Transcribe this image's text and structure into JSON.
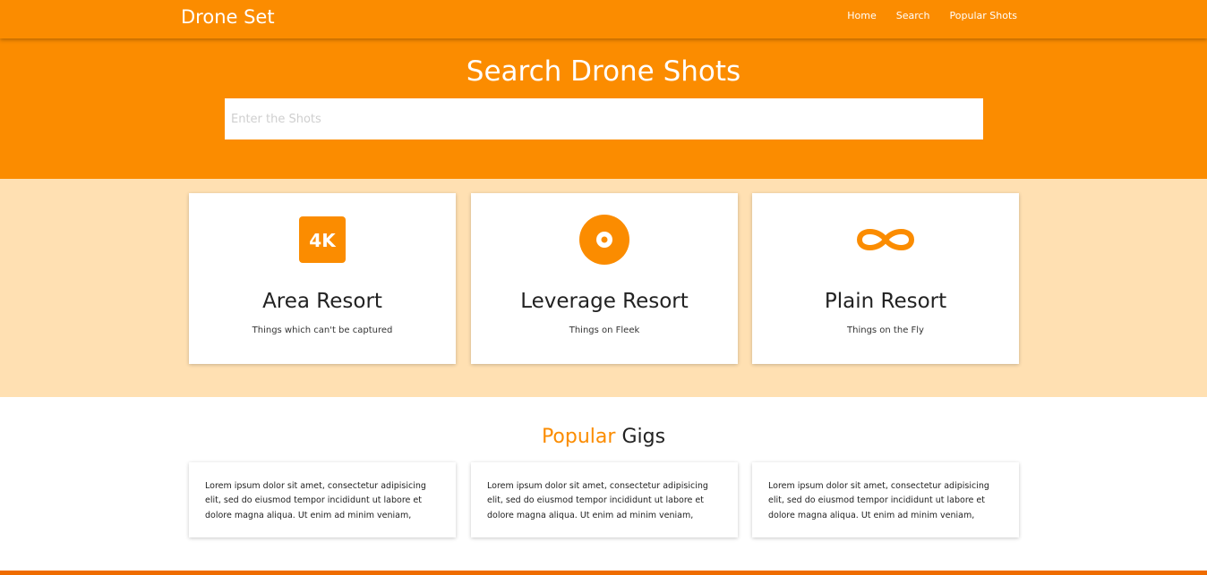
{
  "colors": {
    "primary": "#fb8c00",
    "light": "#ffe0b2",
    "footer": "#ef6c00"
  },
  "nav": {
    "brand": "Drone Set",
    "links": [
      "Home",
      "Search",
      "Popular Shots"
    ]
  },
  "hero": {
    "title": "Search Drone Shots",
    "search_placeholder": "Enter the Shots"
  },
  "features": [
    {
      "icon": "4k-icon",
      "title": "Area Resort",
      "subtitle": "Things which can't be captured"
    },
    {
      "icon": "disc-icon",
      "title": "Leverage Resort",
      "subtitle": "Things on Fleek"
    },
    {
      "icon": "infinity-icon",
      "title": "Plain Resort",
      "subtitle": "Things on the Fly"
    }
  ],
  "popular": {
    "title_accent": "Popular",
    "title_rest": " Gigs",
    "cards": [
      "Lorem ipsum dolor sit amet, consectetur adipisicing elit, sed do eiusmod tempor incididunt ut labore et dolore magna aliqua. Ut enim ad minim veniam,",
      "Lorem ipsum dolor sit amet, consectetur adipisicing elit, sed do eiusmod tempor incididunt ut labore et dolore magna aliqua. Ut enim ad minim veniam,",
      "Lorem ipsum dolor sit amet, consectetur adipisicing elit, sed do eiusmod tempor incididunt ut labore et dolore magna aliqua. Ut enim ad minim veniam,"
    ]
  }
}
